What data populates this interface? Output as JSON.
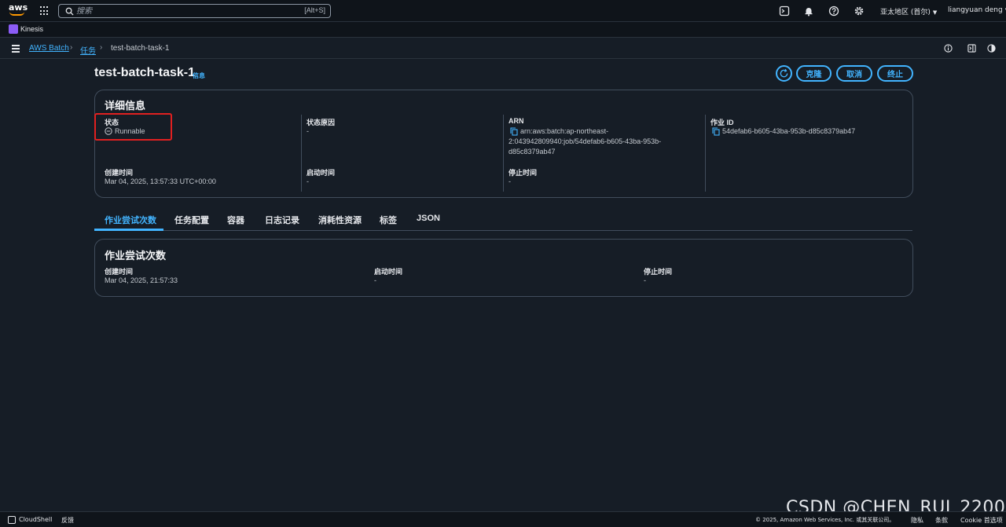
{
  "topnav": {
    "logo_text": "aws",
    "search_placeholder": "搜索",
    "search_shortcut": "[Alt+S]",
    "region": "亚太地区 (首尔)",
    "user": "liangyuan deng",
    "icons": [
      "cloudshell-icon",
      "bell-icon",
      "help-icon",
      "gear-icon"
    ]
  },
  "favorites": {
    "items": [
      {
        "label": "Kinesis"
      }
    ]
  },
  "breadcrumb": {
    "items": [
      {
        "label": "AWS Batch"
      },
      {
        "label": "任务"
      },
      {
        "label": "test-batch-task-1"
      }
    ]
  },
  "header": {
    "title": "test-batch-task-1",
    "info_label": "信息",
    "buttons": {
      "clone": "克隆",
      "cancel": "取消",
      "terminate": "终止"
    }
  },
  "details": {
    "title": "详细信息",
    "status_label": "状态",
    "status_value": "Runnable",
    "status_reason_label": "状态原因",
    "status_reason_value": "-",
    "arn_label": "ARN",
    "arn_value_line1": "arn:aws:batch:ap-northeast-",
    "arn_value_line2": "2:043942809940:job/54defab6-b605-43ba-953b-",
    "arn_value_line3": "d85c8379ab47",
    "job_id_label": "作业 ID",
    "job_id_value": "54defab6-b605-43ba-953b-d85c8379ab47",
    "created_label": "创建时间",
    "created_value": "Mar 04, 2025, 13:57:33 UTC+00:00",
    "started_label": "启动时间",
    "started_value": "-",
    "stopped_label": "停止时间",
    "stopped_value": "-"
  },
  "tabs": [
    {
      "label": "作业尝试次数",
      "active": true
    },
    {
      "label": "任务配置"
    },
    {
      "label": "容器"
    },
    {
      "label": "日志记录"
    },
    {
      "label": "消耗性资源"
    },
    {
      "label": "标签"
    },
    {
      "label": "JSON"
    }
  ],
  "attempts": {
    "title": "作业尝试次数",
    "created_label": "创建时间",
    "created_value": "Mar 04, 2025, 21:57:33",
    "started_label": "启动时间",
    "started_value": "-",
    "stopped_label": "停止时间",
    "stopped_value": "-"
  },
  "footer": {
    "cloudshell": "CloudShell",
    "feedback": "反馈",
    "copyright": "© 2025, Amazon Web Services, Inc. 或其关联公司。",
    "privacy": "隐私",
    "terms": "条款",
    "cookie": "Cookie 首选项"
  },
  "watermark": "CSDN @CHEN_RUI_2200",
  "colors": {
    "accent": "#42b4ff",
    "background": "#161d26",
    "highlight": "#e02020"
  }
}
